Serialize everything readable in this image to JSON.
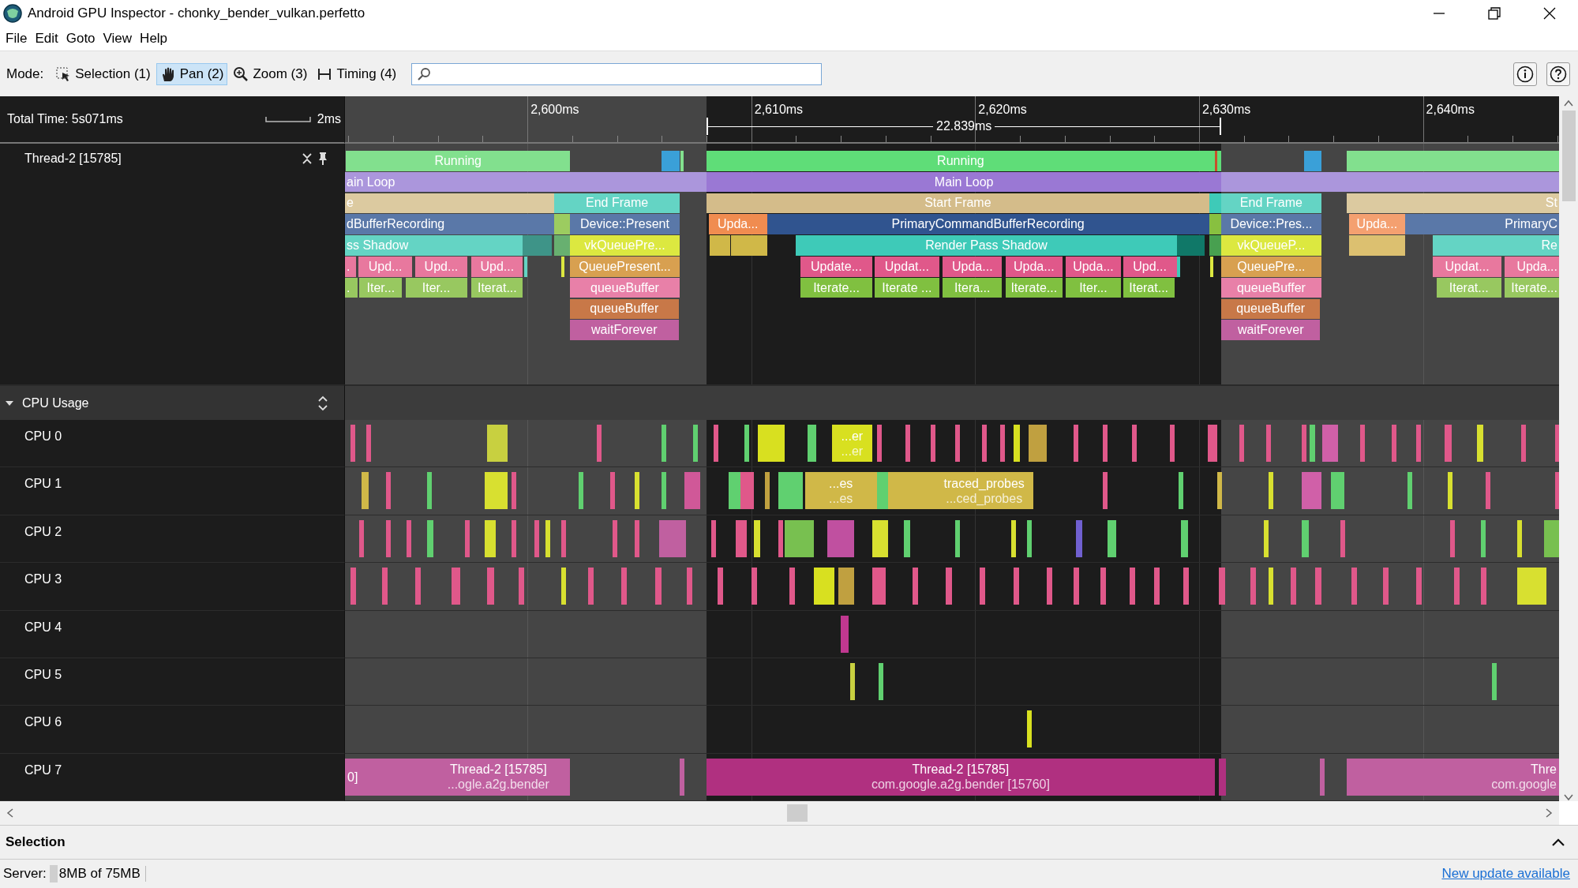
{
  "window": {
    "title": "Android GPU Inspector - chonky_bender_vulkan.perfetto"
  },
  "menu": [
    "File",
    "Edit",
    "Goto",
    "View",
    "Help"
  ],
  "toolbar": {
    "mode_label": "Mode:",
    "modes": [
      {
        "label": "Selection (1)",
        "kind": "selection",
        "selected": false
      },
      {
        "label": "Pan (2)",
        "kind": "pan",
        "selected": true
      },
      {
        "label": "Zoom (3)",
        "kind": "zoom",
        "selected": false
      },
      {
        "label": "Timing (4)",
        "kind": "timing",
        "selected": false
      }
    ]
  },
  "ruler": {
    "total_time": "Total Time: 5s071ms",
    "scale": "2ms",
    "ticks": [
      "2,600ms",
      "2,610ms",
      "2,620ms",
      "2,630ms",
      "2,640ms"
    ],
    "timing_marker": {
      "label": "22.839ms"
    }
  },
  "thread_track": {
    "name": "Thread-2 [15785]",
    "rows": [
      {
        "slices": [
          {
            "color": "#82e08e",
            "label": "Running"
          },
          {
            "color": "#3aa0d8"
          },
          {
            "color": "#82e08e"
          },
          {
            "color": "#5fdd78",
            "label": "Running"
          },
          {
            "color": "#c8502a"
          },
          {
            "color": "#5fdd78"
          },
          {
            "color": "#3aa0d8"
          },
          {
            "color": "#82e08e"
          }
        ]
      },
      {
        "slices": [
          {
            "color": "#ab96dc",
            "label": "ain Loop"
          },
          {
            "color": "#9a78d4",
            "label": "Main Loop"
          },
          {
            "color": "#ab96dc"
          }
        ]
      },
      {
        "slices": [
          {
            "color": "#dccaa0",
            "label": "e"
          },
          {
            "color": "#64d4c4",
            "label": "End Frame"
          },
          {
            "color": "#d4bc8a",
            "label": "Start Frame"
          },
          {
            "color": "#3ecab8"
          },
          {
            "color": "#64d4c4",
            "label": "End Frame"
          },
          {
            "color": "#dccaa0",
            "label": "St"
          }
        ]
      },
      {
        "slices": [
          {
            "color": "#5a78a8",
            "label": "dBufferRecording"
          },
          {
            "color": "#9ccc60"
          },
          {
            "color": "#5a78a8",
            "label": "Device::Present"
          },
          {
            "color": "#f08c50",
            "label": "Upda..."
          },
          {
            "color": "#30548f",
            "label": "PrimaryCommandBufferRecording"
          },
          {
            "color": "#88c040"
          },
          {
            "color": "#5a78a8",
            "label": "Device::Pres..."
          },
          {
            "color": "#f4a070",
            "label": "Upda..."
          },
          {
            "color": "#5a78a8",
            "label": "PrimaryC"
          }
        ]
      },
      {
        "slices": [
          {
            "color": "#64d4c4",
            "label": "ss Shadow"
          },
          {
            "color": "#3e9488"
          },
          {
            "color": "#68b070"
          },
          {
            "color": "#dce840",
            "label": "vkQueuePre..."
          },
          {
            "color": "#d0b848"
          },
          {
            "color": "#d0b848"
          },
          {
            "color": "#3ecab8",
            "label": "Render Pass Shadow"
          },
          {
            "color": "#107868"
          },
          {
            "color": "#48a050"
          },
          {
            "color": "#dce840",
            "label": "vkQueueP..."
          },
          {
            "color": "#dcc070"
          },
          {
            "color": "#64d4c4",
            "label": "Re"
          }
        ]
      },
      {
        "slices": [
          {
            "color": "#e8789e",
            "label": "."
          },
          {
            "color": "#e8789e",
            "label": "Upd..."
          },
          {
            "color": "#e8789e",
            "label": "Upd..."
          },
          {
            "color": "#e8789e",
            "label": "Upd..."
          },
          {
            "color": "#64d4c4"
          },
          {
            "color": "#dce840"
          },
          {
            "color": "#d8a050",
            "label": "QueuePresent..."
          },
          {
            "color": "#e0588a",
            "label": "Update..."
          },
          {
            "color": "#e0588a",
            "label": "Updat..."
          },
          {
            "color": "#e0588a",
            "label": "Upda..."
          },
          {
            "color": "#e0588a",
            "label": "Upda..."
          },
          {
            "color": "#e0588a",
            "label": "Upda..."
          },
          {
            "color": "#e0588a",
            "label": "Upd..."
          },
          {
            "color": "#3ecab8"
          },
          {
            "color": "#dce840"
          },
          {
            "color": "#d8a050",
            "label": "QueuePre..."
          },
          {
            "color": "#e8789e",
            "label": "Updat..."
          },
          {
            "color": "#e8789e",
            "label": "Upda..."
          }
        ]
      },
      {
        "slices": [
          {
            "color": "#98c860",
            "label": "."
          },
          {
            "color": "#98c860",
            "label": "Iter..."
          },
          {
            "color": "#98c860",
            "label": "Iter..."
          },
          {
            "color": "#98c860",
            "label": "Iterat..."
          },
          {
            "color": "#e880a8",
            "label": "queueBuffer"
          },
          {
            "color": "#80c040",
            "label": "Iterate..."
          },
          {
            "color": "#80c040",
            "label": "Iterate ..."
          },
          {
            "color": "#80c040",
            "label": "Itera..."
          },
          {
            "color": "#80c040",
            "label": "Iterate..."
          },
          {
            "color": "#80c040",
            "label": "Iter..."
          },
          {
            "color": "#80c040",
            "label": "Iterat..."
          },
          {
            "color": "#e880a8",
            "label": "queueBuffer"
          },
          {
            "color": "#98c860",
            "label": "Iterat..."
          },
          {
            "color": "#98c860",
            "label": "Iterate..."
          }
        ]
      },
      {
        "slices": [
          {
            "color": "#c87848",
            "label": "queueBuffer"
          },
          {
            "color": "#c87848",
            "label": "queueBuffer"
          }
        ]
      },
      {
        "slices": [
          {
            "color": "#c060a0",
            "label": "waitForever"
          },
          {
            "color": "#c060a0",
            "label": "waitForever"
          }
        ]
      }
    ]
  },
  "cpu_usage": {
    "title": "CPU Usage",
    "expanded": true,
    "cpus": [
      {
        "name": "CPU 0",
        "slices": [
          {
            "color": "#e0588a"
          },
          {
            "color": "#e0588a"
          },
          {
            "color": "#c8d040"
          },
          {
            "color": "#e0588a"
          },
          {
            "color": "#60d070"
          },
          {
            "color": "#60d070"
          },
          {
            "color": "#e0588a"
          },
          {
            "color": "#60d070"
          },
          {
            "color": "#d8e020"
          },
          {
            "color": "#60d070"
          },
          {
            "color": "#d8e020",
            "label": "...er",
            "sublabel": "...er"
          },
          {
            "color": "#e0588a"
          },
          {
            "color": "#e0588a"
          },
          {
            "color": "#e0588a"
          },
          {
            "color": "#e0588a"
          },
          {
            "color": "#e0588a"
          },
          {
            "color": "#e0588a"
          },
          {
            "color": "#d8e020"
          },
          {
            "color": "#c0a040"
          },
          {
            "color": "#e0588a"
          },
          {
            "color": "#e0588a"
          },
          {
            "color": "#e0588a"
          },
          {
            "color": "#e0588a"
          },
          {
            "color": "#e0588a"
          },
          {
            "color": "#e0588a"
          },
          {
            "color": "#e0588a"
          },
          {
            "color": "#e0588a"
          },
          {
            "color": "#60d070"
          },
          {
            "color": "#d060a8"
          },
          {
            "color": "#e0588a"
          },
          {
            "color": "#e0588a"
          },
          {
            "color": "#e0588a"
          },
          {
            "color": "#e0588a"
          },
          {
            "color": "#d8e030"
          },
          {
            "color": "#e0588a"
          },
          {
            "color": "#e0588a"
          }
        ]
      },
      {
        "name": "CPU 1",
        "slices": [
          {
            "color": "#d0b848"
          },
          {
            "color": "#e0588a"
          },
          {
            "color": "#60d070"
          },
          {
            "color": "#d8e030"
          },
          {
            "color": "#e0588a"
          },
          {
            "color": "#60d070"
          },
          {
            "color": "#e0588a"
          },
          {
            "color": "#d8e030"
          },
          {
            "color": "#60d070"
          },
          {
            "color": "#d05898"
          },
          {
            "color": "#60d070"
          },
          {
            "color": "#e0588a"
          },
          {
            "color": "#c0a040"
          },
          {
            "color": "#60d070"
          },
          {
            "color": "#d0b848",
            "label": "...es",
            "sublabel": "...es"
          },
          {
            "color": "#60d070"
          },
          {
            "color": "#d0b848"
          },
          {
            "color": "#d0b848",
            "label": "traced_probes",
            "sublabel": "...ced_probes"
          },
          {
            "color": "#e0588a"
          },
          {
            "color": "#60d070"
          },
          {
            "color": "#d0b848"
          },
          {
            "color": "#d8e030"
          },
          {
            "color": "#d060a8"
          },
          {
            "color": "#60d070"
          },
          {
            "color": "#60d070"
          },
          {
            "color": "#d8e030"
          },
          {
            "color": "#e0588a"
          },
          {
            "color": "#e0588a"
          }
        ]
      },
      {
        "name": "CPU 2",
        "slices": [
          {
            "color": "#e0588a"
          },
          {
            "color": "#e0588a"
          },
          {
            "color": "#e0588a"
          },
          {
            "color": "#60d070"
          },
          {
            "color": "#e0588a"
          },
          {
            "color": "#d8e030"
          },
          {
            "color": "#e0588a"
          },
          {
            "color": "#e0588a"
          },
          {
            "color": "#d8e030"
          },
          {
            "color": "#e0588a"
          },
          {
            "color": "#e0588a"
          },
          {
            "color": "#e0588a"
          },
          {
            "color": "#c060a0"
          },
          {
            "color": "#e0588a"
          },
          {
            "color": "#e0588a"
          },
          {
            "color": "#d8e030"
          },
          {
            "color": "#e0588a"
          },
          {
            "color": "#78c050"
          },
          {
            "color": "#c050a0"
          },
          {
            "color": "#d8e030"
          },
          {
            "color": "#60d070"
          },
          {
            "color": "#60d070"
          },
          {
            "color": "#d8e030"
          },
          {
            "color": "#60d070"
          },
          {
            "color": "#7060d0"
          },
          {
            "color": "#60d070"
          },
          {
            "color": "#60d070"
          },
          {
            "color": "#d8e030"
          },
          {
            "color": "#60d070"
          },
          {
            "color": "#e0588a"
          },
          {
            "color": "#e0588a"
          },
          {
            "color": "#60d070"
          },
          {
            "color": "#d8e030"
          },
          {
            "color": "#78c050"
          }
        ]
      },
      {
        "name": "CPU 3",
        "slices": [
          {
            "color": "#e0588a"
          },
          {
            "color": "#e0588a"
          },
          {
            "color": "#e0588a"
          },
          {
            "color": "#e0588a"
          },
          {
            "color": "#e0588a"
          },
          {
            "color": "#e0588a"
          },
          {
            "color": "#d8e030"
          },
          {
            "color": "#e0588a"
          },
          {
            "color": "#e0588a"
          },
          {
            "color": "#e0588a"
          },
          {
            "color": "#e0588a"
          },
          {
            "color": "#e0588a"
          },
          {
            "color": "#e0588a"
          },
          {
            "color": "#e0588a"
          },
          {
            "color": "#d8e020"
          },
          {
            "color": "#c0a040"
          },
          {
            "color": "#e0588a"
          },
          {
            "color": "#e0588a"
          },
          {
            "color": "#e0588a"
          },
          {
            "color": "#e0588a"
          },
          {
            "color": "#e0588a"
          },
          {
            "color": "#e0588a"
          },
          {
            "color": "#e0588a"
          },
          {
            "color": "#e0588a"
          },
          {
            "color": "#e0588a"
          },
          {
            "color": "#e0588a"
          },
          {
            "color": "#e0588a"
          },
          {
            "color": "#e0588a"
          },
          {
            "color": "#e0588a"
          },
          {
            "color": "#d8e030"
          },
          {
            "color": "#e0588a"
          },
          {
            "color": "#e0588a"
          },
          {
            "color": "#e0588a"
          },
          {
            "color": "#e0588a"
          },
          {
            "color": "#e0588a"
          },
          {
            "color": "#e0588a"
          },
          {
            "color": "#e0588a"
          },
          {
            "color": "#d8e030"
          }
        ]
      },
      {
        "name": "CPU 4",
        "slices": [
          {
            "color": "#c03890"
          }
        ]
      },
      {
        "name": "CPU 5",
        "slices": [
          {
            "color": "#c8d040"
          },
          {
            "color": "#60d070"
          },
          {
            "color": "#60d070"
          }
        ]
      },
      {
        "name": "CPU 6",
        "slices": [
          {
            "color": "#d8e020"
          }
        ]
      },
      {
        "name": "CPU 7",
        "slices": [
          {
            "color": "#c060a0",
            "label": "0]"
          },
          {
            "color": "#c060a0",
            "label": "Thread-2 [15785]",
            "sublabel": "...ogle.a2g.bender"
          },
          {
            "color": "#c060a0"
          },
          {
            "color": "#b03080",
            "label": "Thread-2 [15785]",
            "sublabel": "com.google.a2g.bender [15760]"
          },
          {
            "color": "#b03080"
          },
          {
            "color": "#c060a0"
          },
          {
            "color": "#c060a0",
            "label": "Thre",
            "sublabel": "com.google"
          }
        ]
      }
    ]
  },
  "selection_panel": {
    "title": "Selection",
    "expanded": false
  },
  "status_bar": {
    "server_label": "Server:",
    "memory": "8MB of 75MB",
    "update_link": "New update available"
  }
}
